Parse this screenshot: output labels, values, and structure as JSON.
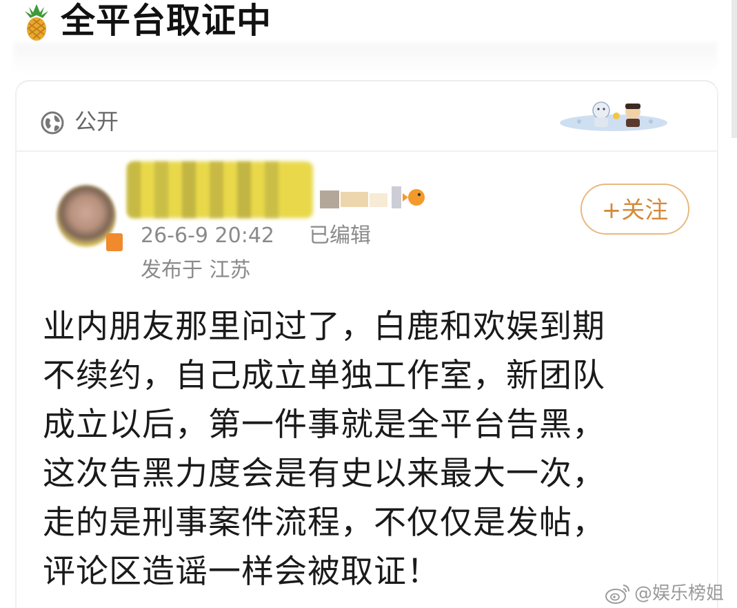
{
  "header": {
    "title": "全平台取证中",
    "icon": "pineapple-icon"
  },
  "card": {
    "visibility": {
      "icon": "globe-icon",
      "label": "公开"
    },
    "author": {
      "timestamp": "26-6-9 20:42",
      "edited_label": "已编辑",
      "location": "发布于 江苏",
      "follow_label": "+关注"
    },
    "post": {
      "lines": [
        "业内朋友那里问过了，白鹿和欢娱到期",
        "不续约，自己成立单独工作室，新团队",
        "成立以后，第一件事就是全平台告黑，",
        "这次告黑力度会是有史以来最大一次，",
        "走的是刑事案件流程，不仅仅是发帖，",
        "评论区造谣一样会被取证！"
      ]
    }
  },
  "watermark": {
    "text": "@娱乐榜姐",
    "icon": "weibo-icon"
  },
  "colors": {
    "accent": "#d48a3a",
    "follow_border": "#e8b87e",
    "meta_text": "#8a8a8a"
  }
}
